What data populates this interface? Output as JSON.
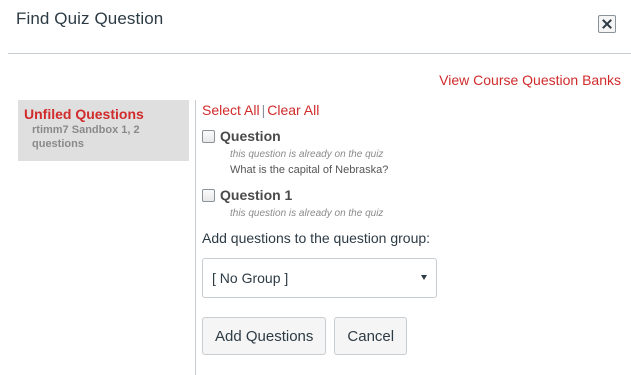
{
  "dialog": {
    "title": "Find Quiz Question",
    "close_icon": "close-x-icon"
  },
  "view_banks_link": "View Course Question Banks",
  "bank": {
    "name": "Unfiled Questions",
    "meta": "rtimm7 Sandbox 1, 2 questions"
  },
  "selection": {
    "select_all": "Select All",
    "separator": "|",
    "clear_all": "Clear All"
  },
  "questions": [
    {
      "name": "Question",
      "note": "this question is already on the quiz",
      "text": "What is the capital of Nebraska?"
    },
    {
      "name": "Question 1",
      "note": "this question is already on the quiz"
    }
  ],
  "group": {
    "label": "Add questions to the question group:",
    "selected": "[ No Group ]",
    "dropdown_icon": "caret-down-icon"
  },
  "actions": {
    "add_label": "Add Questions",
    "cancel_label": "Cancel"
  },
  "colors": {
    "accent": "#d12b2b",
    "text": "#2d3b45",
    "bank_bg": "#dfdfdf",
    "border": "#c7cdd1"
  }
}
